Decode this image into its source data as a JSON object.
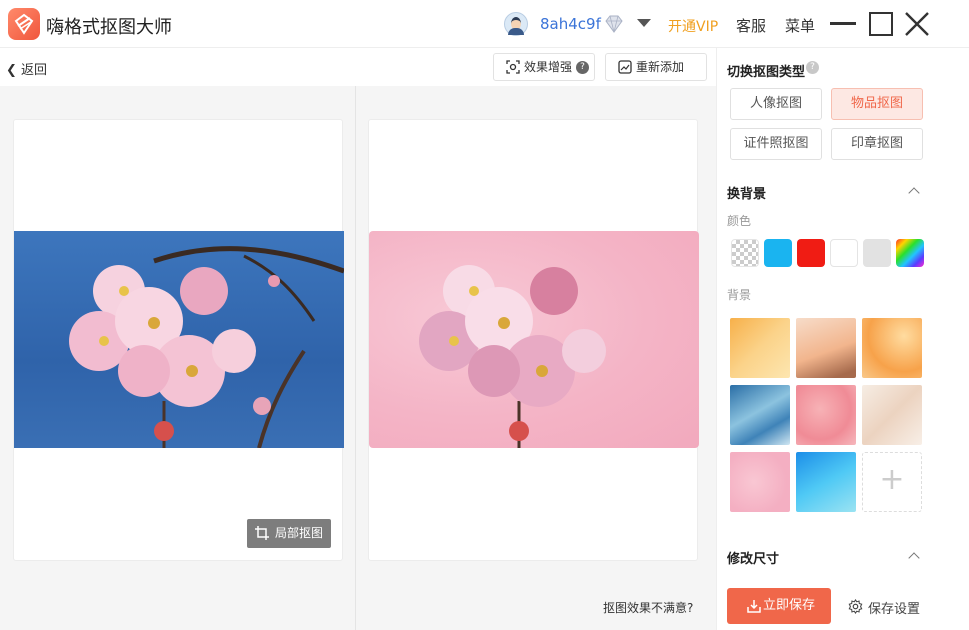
{
  "app": {
    "title": "嗨格式抠图大师"
  },
  "titlebar": {
    "username": "8ah4c9f",
    "vip_label": "开通VIP",
    "service_label": "客服",
    "menu_label": "菜单",
    "icons": [
      "avatar",
      "diamond-icon",
      "caret-down-icon",
      "minimize-icon",
      "maximize-icon",
      "close-icon"
    ]
  },
  "toolbar": {
    "back_label": "返回",
    "enhance_label": "效果增强",
    "enhance_help": "?",
    "readd_label": "重新添加"
  },
  "canvas": {
    "crop_label": "局部抠图",
    "unsatisfied_label": "抠图效果不满意?"
  },
  "panel": {
    "type_title": "切换抠图类型",
    "type_help": "?",
    "types": [
      "人像抠图",
      "物品抠图",
      "证件照抠图",
      "印章抠图"
    ],
    "active_type": "物品抠图",
    "bg_section_title": "换背景",
    "color_label": "颜色",
    "colors": [
      "transparent",
      "#1ab4f0",
      "#f01c14",
      "#ffffff",
      "#e2e2e2",
      "rainbow"
    ],
    "bg_label": "背景",
    "bg_add": "+",
    "resize_title": "修改尺寸",
    "save_label": "立即保存",
    "save_settings_label": "保存设置"
  },
  "colors": {
    "accent": "#f0674a",
    "link": "#3b74d8",
    "vip": "#f0a020"
  }
}
